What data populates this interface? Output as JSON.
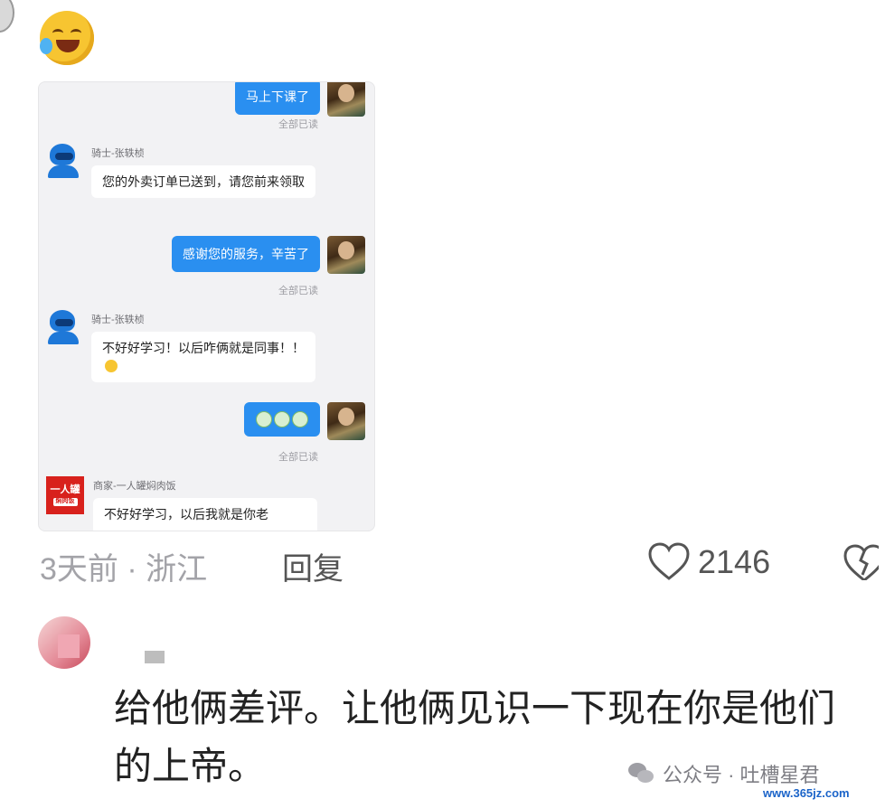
{
  "chat": {
    "messages": [
      {
        "side": "right",
        "text": "马上下课了",
        "status": "全部已读"
      },
      {
        "side": "left",
        "sender": "骑士-张轶桢",
        "text": "您的外卖订单已送到，请您前来领取"
      },
      {
        "side": "right",
        "text": "感谢您的服务，辛苦了",
        "status": "全部已读"
      },
      {
        "side": "left",
        "sender": "骑士-张轶桢",
        "text": "不好好学习！以后咋俩就是同事！！"
      },
      {
        "side": "right",
        "text": "",
        "status": "全部已读"
      },
      {
        "side": "left",
        "sender": "商家-一人罐焖肉饭",
        "text": "不好好学习，以后我就是你老"
      }
    ],
    "shop_avatar_text": "一人罐",
    "shop_avatar_sub": "焖肉饭"
  },
  "comment_meta": {
    "time_location": "3天前 · 浙江",
    "reply_label": "回复",
    "like_count": "2146"
  },
  "reply_comment": {
    "text": "给他俩差评。让他俩见识一下现在你是他们的上帝。"
  },
  "watermark": {
    "account": "公众号 · 吐槽星君",
    "site": "www.365jz.com"
  },
  "icons": {
    "top_emoji": "laughing-crying-emoji-icon",
    "like": "heart-outline-icon",
    "dislike": "broken-heart-icon",
    "wechat": "wechat-icon"
  }
}
